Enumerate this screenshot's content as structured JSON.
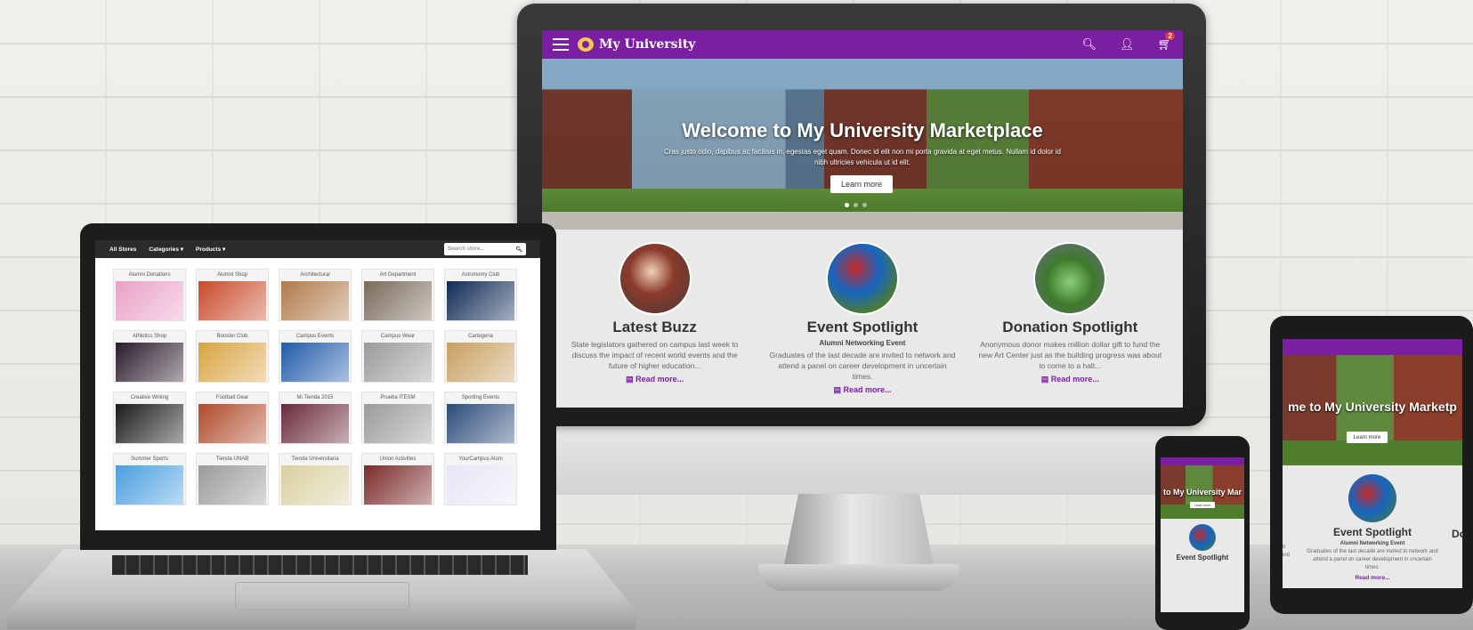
{
  "desktop": {
    "brand": "My University",
    "cart_count": "2",
    "hero": {
      "title": "Welcome to My University Marketplace",
      "body": "Cras justo odio, dapibus ac facilisis in, egestas eget quam. Donec id elit non mi porta gravida at eget metus. Nullam id dolor id nibh ultricies vehicula ut id elit.",
      "button": "Learn more"
    },
    "features": [
      {
        "title": "Latest Buzz",
        "subtitle": "",
        "text": "State legislators gathered on campus last week to discuss the impact of recent world events and the future of higher education...",
        "link": "Read more..."
      },
      {
        "title": "Event Spotlight",
        "subtitle": "Alumni Networking Event",
        "text": "Graduates of the last decade are invited to network and attend a panel on career development in uncertain times.",
        "link": "Read more..."
      },
      {
        "title": "Donation Spotlight",
        "subtitle": "",
        "text": "Anonymous donor makes million dollar gift to fund the new Art Center just as the building progress was about to come to a halt...",
        "link": "Read more..."
      }
    ]
  },
  "laptop": {
    "nav": [
      "All Stores",
      "Categories ▾",
      "Products ▾"
    ],
    "search_placeholder": "Search store...",
    "stores": [
      "Alumni Donations",
      "Alumni Shop",
      "Architectural",
      "Art Department",
      "Astronomy Club",
      "Athletics Shop",
      "Booster Club",
      "Campus Events",
      "Campus Wear",
      "Cartegena",
      "Creative Writing",
      "Football Gear",
      "Mi Tienda 2015",
      "Prueba ITESM",
      "Sporting Events",
      "Summer Sports",
      "Tienda UNAB",
      "Tienda Universitaria",
      "Union Activities",
      "YourCampus Alum"
    ],
    "store_colors": [
      "#e9a0c8",
      "#c94a2a",
      "#b07a4a",
      "#7a6a5a",
      "#0f2a55",
      "#2a1a2a",
      "#d9a441",
      "#1f5aa8",
      "#9a9a9a",
      "#c8a060",
      "#1a1a1a",
      "#b04a2a",
      "#6a2a3a",
      "#9a9a9a",
      "#2a4a7a",
      "#4aa0e0",
      "#9a9a9a",
      "#d9d0a0",
      "#7a2a2a",
      "#e6e6f6"
    ]
  },
  "phone": {
    "hero_title": "to My University Mar",
    "button": "Learn more",
    "feature_title": "Event Spotlight"
  },
  "tablet": {
    "hero_title": "me to My University Marketp",
    "button": "Learn more",
    "feature_title": "Event Spotlight",
    "feature_subtitle": "Alumni Networking Event",
    "feature_text": "Graduates of the last decade are invited to network and attend a panel on career development in uncertain times.",
    "feature_link": "Read more...",
    "left_peek": "nt\nand",
    "right_peek": "Do"
  }
}
